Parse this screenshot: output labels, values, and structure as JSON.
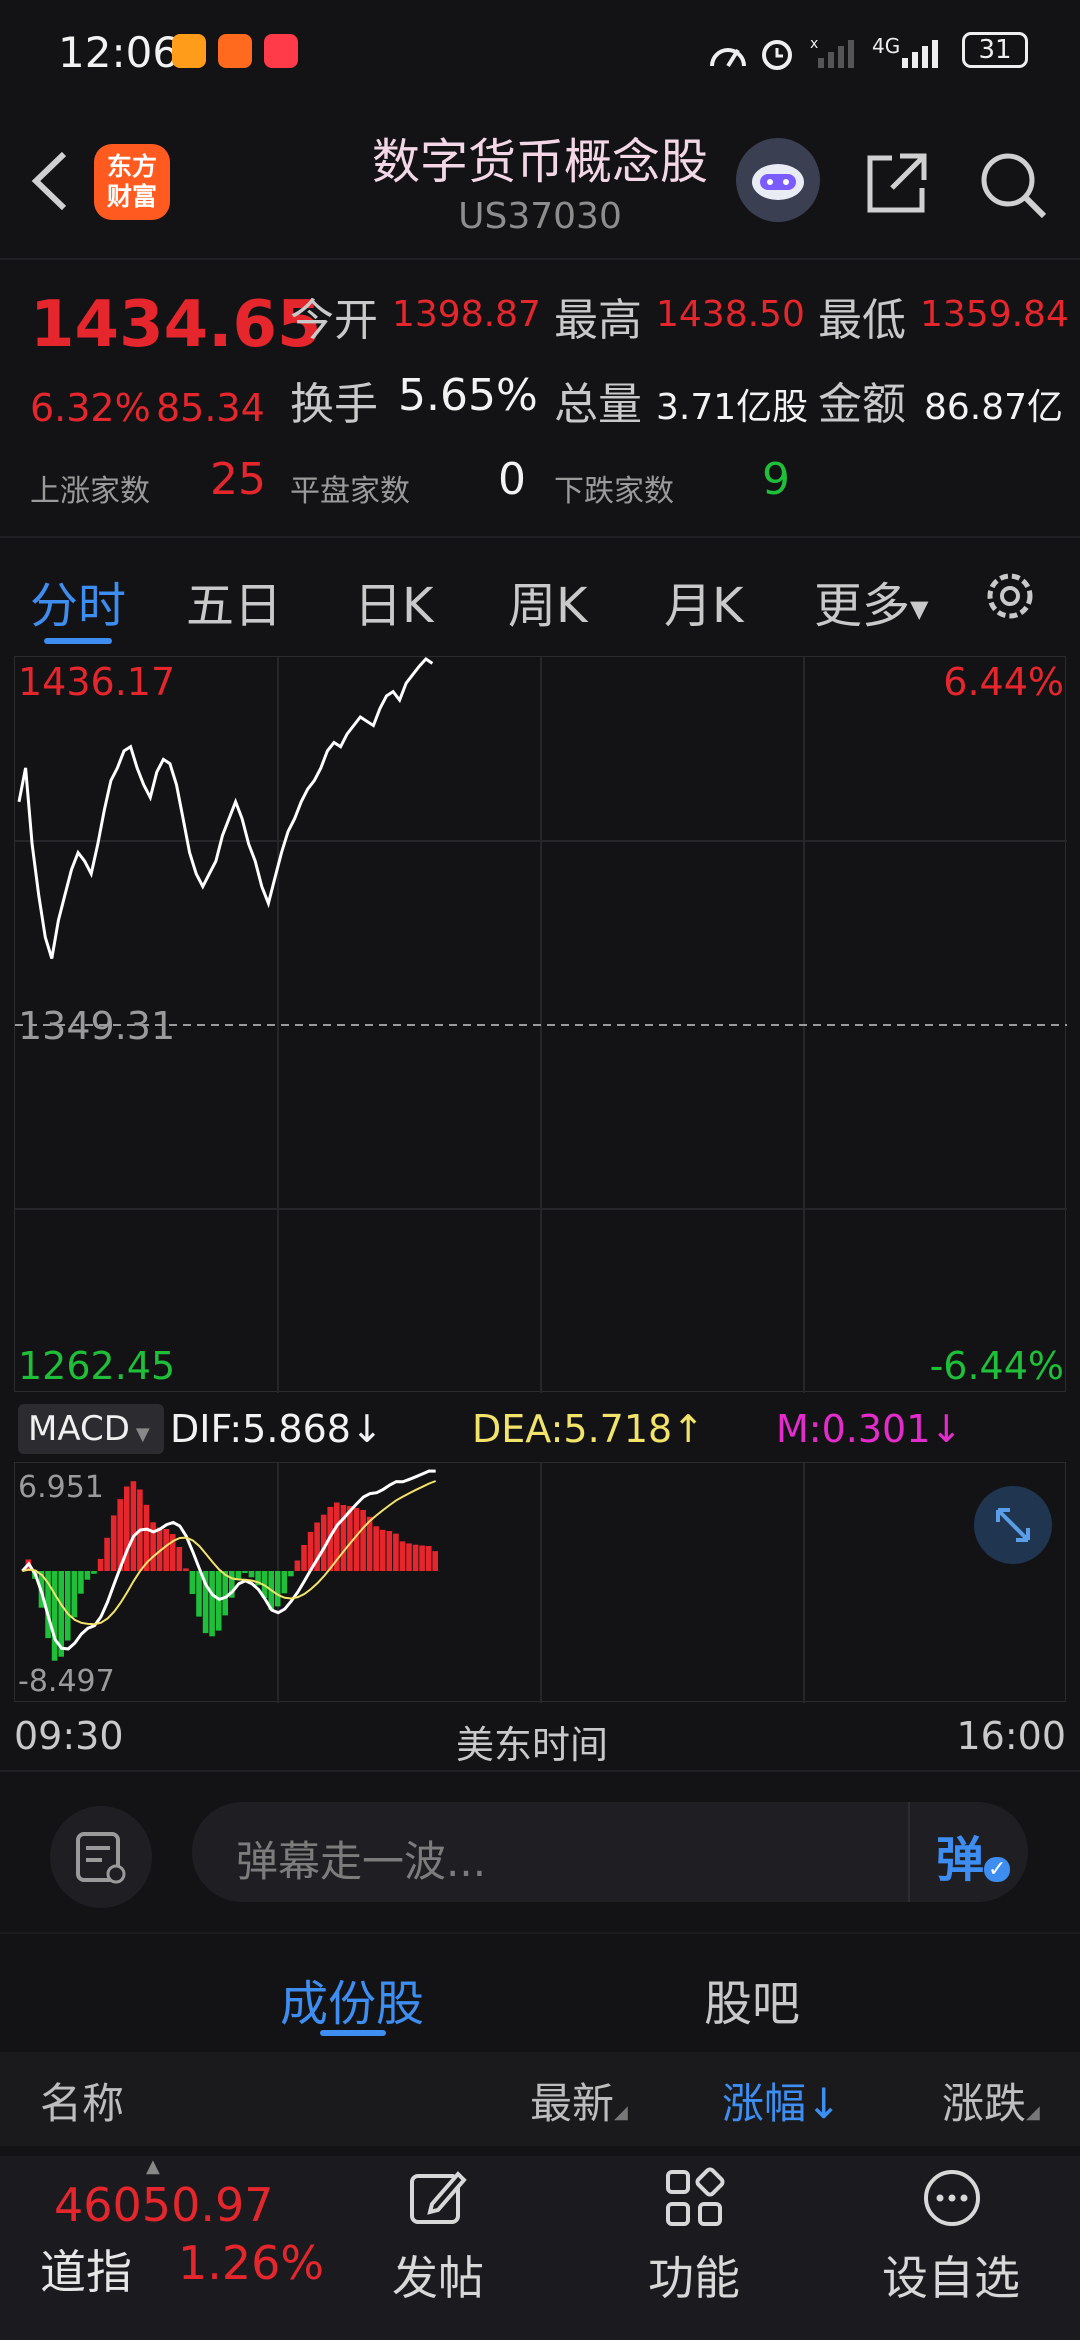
{
  "status_bar": {
    "time": "12:06",
    "network": "4G",
    "battery": "31"
  },
  "header": {
    "logo_line1": "东方",
    "logo_line2": "财富",
    "title": "数字货币概念股",
    "code": "US37030",
    "icons": [
      "back-icon",
      "robot-assistant-icon",
      "share-icon",
      "search-icon"
    ]
  },
  "quote": {
    "price": "1434.65",
    "change_pct": "6.32%",
    "change_amt": "85.34",
    "open_label": "今开",
    "open": "1398.87",
    "high_label": "最高",
    "high": "1438.50",
    "low_label": "最低",
    "low": "1359.84",
    "turnover_label": "换手",
    "turnover": "5.65%",
    "volume_label": "总量",
    "volume": "3.71亿股",
    "amount_label": "金额",
    "amount": "86.87亿",
    "up_label": "上涨家数",
    "up_count": "25",
    "flat_label": "平盘家数",
    "flat_count": "0",
    "down_label": "下跌家数",
    "down_count": "9"
  },
  "tabs": [
    "分时",
    "五日",
    "日K",
    "周K",
    "月K",
    "更多"
  ],
  "chart": {
    "top_price": "1436.17",
    "top_pct": "6.44%",
    "mid_price": "1349.31",
    "bottom_price": "1262.45",
    "bottom_pct": "-6.44%",
    "indicator": "MACD",
    "dif": "DIF:5.868",
    "dea": "DEA:5.718",
    "m": "M:0.301",
    "macd_max": "6.951",
    "macd_min": "-8.497",
    "time_start": "09:30",
    "time_label": "美东时间",
    "time_end": "16:00",
    "colors": {
      "up": "#e5272d",
      "down": "#1fbf3a",
      "price_line": "#ffffff",
      "dea_line": "#f2e36b"
    }
  },
  "chart_data": {
    "type": "line",
    "title": "",
    "xlabel": "美东时间",
    "ylabel": "",
    "x_range": [
      "09:30",
      "16:00"
    ],
    "ylim": [
      1262.45,
      1436.17
    ],
    "reference_price": 1349.31,
    "series": [
      {
        "values": [
          1402,
          1410,
          1392,
          1380,
          1370,
          1365,
          1374,
          1380,
          1386,
          1390,
          1388,
          1385,
          1392,
          1400,
          1407,
          1410,
          1414,
          1415,
          1410,
          1406,
          1403,
          1409,
          1412,
          1411,
          1406,
          1398,
          1390,
          1385,
          1382,
          1385,
          1388,
          1394,
          1398,
          1402,
          1398,
          1392,
          1388,
          1382,
          1378,
          1384,
          1390,
          1395,
          1398,
          1402,
          1405,
          1407,
          1410,
          1414,
          1416,
          1415,
          1418,
          1420,
          1422,
          1421,
          1420,
          1424,
          1427,
          1428,
          1426,
          1430,
          1432,
          1434,
          1436,
          1434.65
        ]
      }
    ]
  },
  "danmaku": {
    "placeholder": "弹幕走一波...",
    "button": "弹"
  },
  "bottom_tabs": [
    "成份股",
    "股吧"
  ],
  "columns": {
    "name": "名称",
    "latest": "最新",
    "change_pct": "涨幅",
    "change": "涨跌"
  },
  "footer": {
    "index_value": "46050.97",
    "index_name": "道指",
    "index_change": "1.26%",
    "nav": [
      "发帖",
      "功能",
      "设自选"
    ]
  }
}
